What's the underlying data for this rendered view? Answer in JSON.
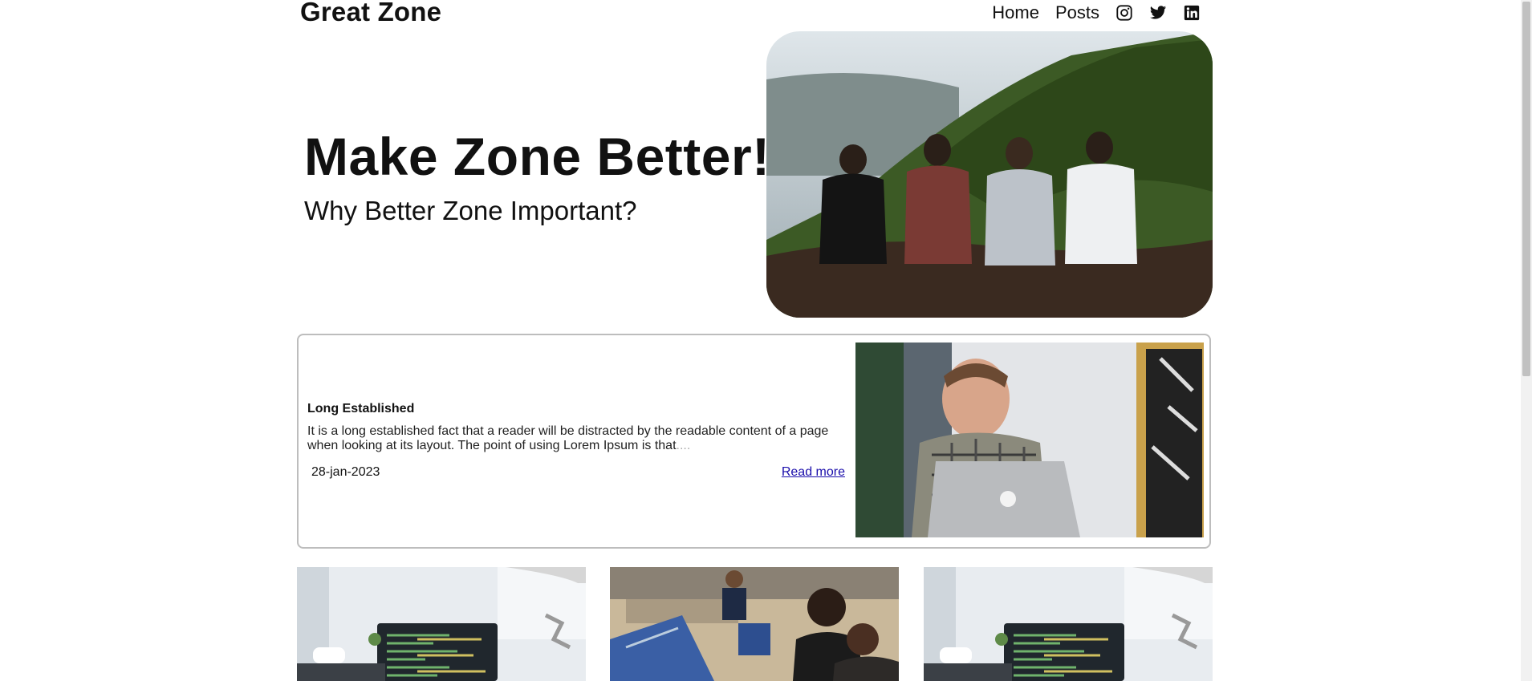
{
  "header": {
    "brand": "Great Zone",
    "nav": [
      {
        "label": "Home"
      },
      {
        "label": "Posts"
      }
    ],
    "social_icons": [
      "instagram-icon",
      "twitter-icon",
      "linkedin-icon"
    ]
  },
  "hero": {
    "title": "Make Zone Better!",
    "subtitle": "Why Better Zone Important?",
    "image": "four-friends-sitting-on-mountain-photo"
  },
  "featured": {
    "title": "Long Established",
    "excerpt": "It is a long established fact that a reader will be distracted by the readable content of a page when looking at its layout. The point of using Lorem Ipsum is that",
    "ellipsis": "....",
    "date": "28-jan-2023",
    "read_more": "Read more",
    "image": "man-with-laptop-photo"
  },
  "grid": {
    "images": [
      "code-on-monitor-photo",
      "people-working-at-laptops-photo",
      "code-on-monitor-photo"
    ]
  },
  "colors": {
    "text": "#111111",
    "link": "#1a0dab",
    "card_border": "#bdbdbd"
  }
}
